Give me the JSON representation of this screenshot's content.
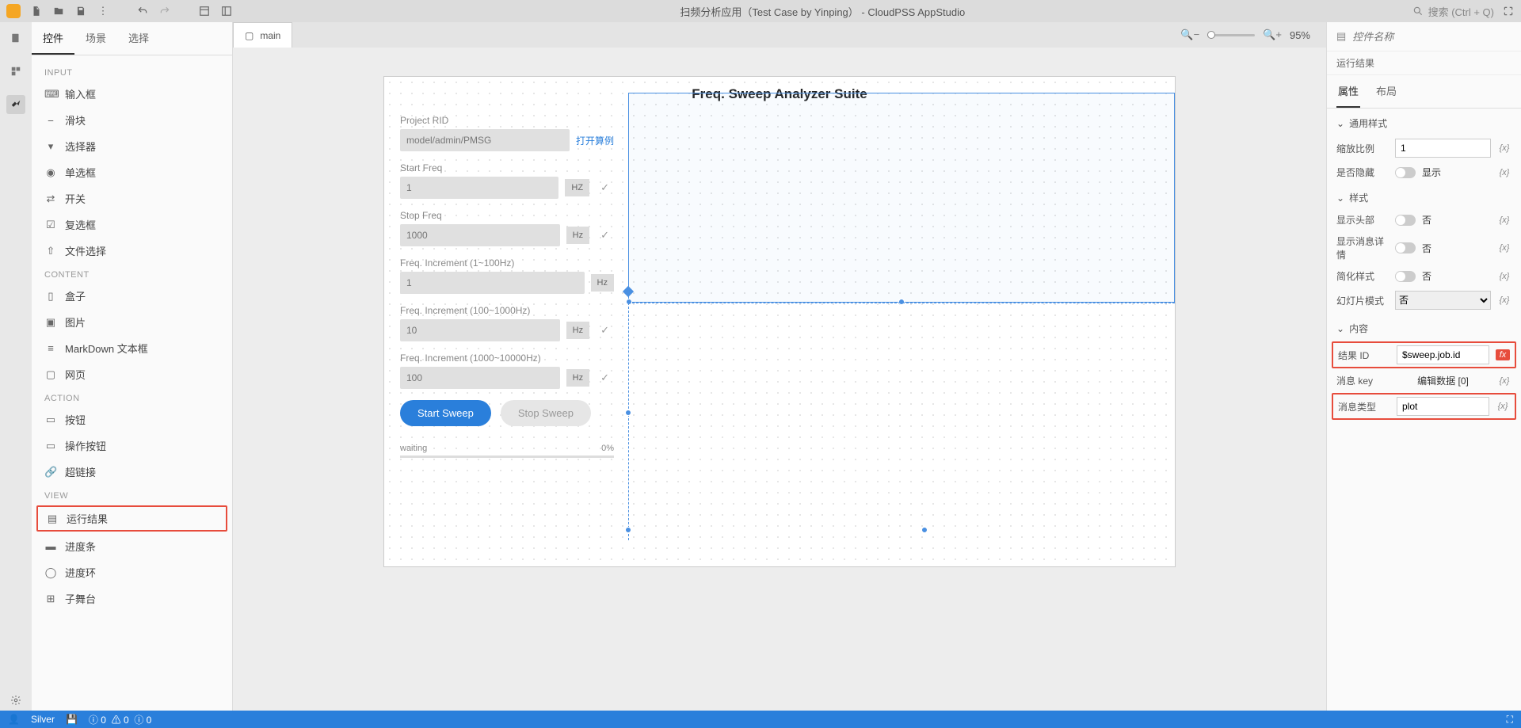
{
  "titlebar": {
    "title": "扫频分析应用（Test Case by Yinping）  - CloudPSS AppStudio",
    "search_placeholder": "搜索 (Ctrl + Q)"
  },
  "leftpanel": {
    "tabs": {
      "widgets": "控件",
      "scenes": "场景",
      "select": "选择"
    },
    "groups": {
      "input": "INPUT",
      "content": "CONTENT",
      "action": "ACTION",
      "view": "VIEW"
    },
    "items": {
      "input_box": "输入框",
      "slider": "滑块",
      "selector": "选择器",
      "radio": "单选框",
      "switch": "开关",
      "checkbox": "复选框",
      "file_select": "文件选择",
      "box": "盒子",
      "image": "图片",
      "markdown": "MarkDown 文本框",
      "webpage": "网页",
      "button": "按钮",
      "action_button": "操作按钮",
      "hyperlink": "超链接",
      "run_result": "运行结果",
      "progress_bar": "进度条",
      "progress_ring": "进度环",
      "sub_stage": "子舞台"
    }
  },
  "tabbar": {
    "main_tab": "main",
    "zoom": "95%"
  },
  "canvas": {
    "title": "Freq. Sweep Analyzer Suite",
    "fields": {
      "project_rid": {
        "label": "Project RID",
        "value": "model/admin/PMSG",
        "link": "打开算例"
      },
      "start_freq": {
        "label": "Start Freq",
        "value": "1",
        "unit": "HZ"
      },
      "stop_freq": {
        "label": "Stop Freq",
        "value": "1000",
        "unit": "Hz"
      },
      "inc1": {
        "label": "Freq. Increment (1~100Hz)",
        "value": "1",
        "unit": "Hz"
      },
      "inc2": {
        "label": "Freq. Increment (100~1000Hz)",
        "value": "10",
        "unit": "Hz"
      },
      "inc3": {
        "label": "Freq. Increment (1000~10000Hz)",
        "value": "100",
        "unit": "Hz"
      }
    },
    "buttons": {
      "start": "Start Sweep",
      "stop": "Stop Sweep"
    },
    "progress": {
      "label": "waiting",
      "pct": "0%"
    }
  },
  "rightpanel": {
    "name_placeholder": "控件名称",
    "subtitle": "运行结果",
    "tabs": {
      "props": "属性",
      "layout": "布局"
    },
    "sections": {
      "general": "通用样式",
      "style": "样式",
      "content": "内容"
    },
    "rows": {
      "scale": {
        "label": "缩放比例",
        "value": "1"
      },
      "hidden": {
        "label": "是否隐藏",
        "text": "显示"
      },
      "show_header": {
        "label": "显示头部",
        "text": "否"
      },
      "show_detail": {
        "label": "显示消息详情",
        "text": "否"
      },
      "simple": {
        "label": "简化样式",
        "text": "否"
      },
      "slideshow": {
        "label": "幻灯片模式",
        "value": "否"
      },
      "result_id": {
        "label": "结果 ID",
        "value": "$sweep.job.id"
      },
      "msg_key": {
        "label": "消息 key",
        "value": "编辑数据 [0]"
      },
      "msg_type": {
        "label": "消息类型",
        "value": "plot"
      }
    },
    "fx": "{x}"
  },
  "statusbar": {
    "user": "Silver",
    "errors": "0",
    "warnings": "0",
    "info": "0"
  }
}
